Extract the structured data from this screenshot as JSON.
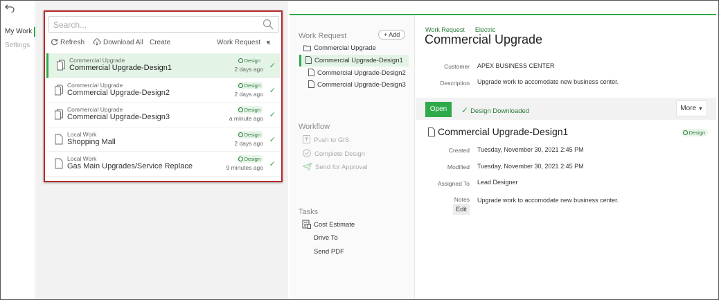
{
  "rail": {
    "back_icon": "undo-arrow-icon",
    "items": [
      {
        "label": "My Work",
        "active": true
      },
      {
        "label": "Settings",
        "active": false
      }
    ]
  },
  "list": {
    "search_placeholder": "Search...",
    "toolbar": {
      "refresh": "Refresh",
      "download_all": "Download All",
      "create": "Create",
      "sort_label": "Work Request"
    },
    "rows": [
      {
        "category": "Commercial Upgrade",
        "title": "Commercial Upgrade-Design1",
        "badge": "Design",
        "time": "2 days ago",
        "selected": true
      },
      {
        "category": "Commercial Upgrade",
        "title": "Commercial Upgrade-Design2",
        "badge": "Design",
        "time": "2 days ago",
        "selected": false
      },
      {
        "category": "Commercial Upgrade",
        "title": "Commercial Upgrade-Design3",
        "badge": "Design",
        "time": "a minute ago",
        "selected": false
      },
      {
        "category": "Local Work",
        "title": "Shopping Mall",
        "badge": "Design",
        "time": "2 days ago",
        "selected": false
      },
      {
        "category": "Local Work",
        "title": "Gas Main Upgrades/Service Replace",
        "badge": "Design",
        "time": "9 minutes ago",
        "selected": false
      }
    ]
  },
  "nav": {
    "work_request_title": "Work Request",
    "add_label": "+ Add",
    "tree": {
      "parent": "Commercial Upgrade",
      "children": [
        "Commercial Upgrade-Design1",
        "Commercial Upgrade-Design2",
        "Commercial Upgrade-Design3"
      ]
    },
    "workflow_title": "Workflow",
    "workflow": [
      "Push to GIS",
      "Complete Design",
      "Send for Approval"
    ],
    "tasks_title": "Tasks",
    "tasks": [
      "Cost Estimate",
      "Drive To",
      "Send PDF"
    ]
  },
  "detail": {
    "breadcrumb": [
      "Work Request",
      "Electric"
    ],
    "title": "Commercial Upgrade",
    "customer_label": "Customer",
    "customer": "APEX BUSINESS CENTER",
    "description_label": "Description",
    "description": "Upgrade work to accomodate new business center.",
    "open_label": "Open",
    "downloaded_label": "Design Downloaded",
    "more_label": "More",
    "design_title": "Commercial Upgrade-Design1",
    "design_badge": "Design",
    "created_label": "Created",
    "created": "Tuesday, November 30, 2021 2:45 PM",
    "modified_label": "Modified",
    "modified": "Tuesday, November 30, 2021 2:45 PM",
    "assigned_label": "Assigned To",
    "assigned": "Lead Designer",
    "notes_label": "Notes",
    "notes": "Upgrade work to accomodate new business center.",
    "edit_label": "Edit"
  },
  "colors": {
    "accent": "#2eaa4b",
    "highlight_border": "#b52a2a"
  }
}
